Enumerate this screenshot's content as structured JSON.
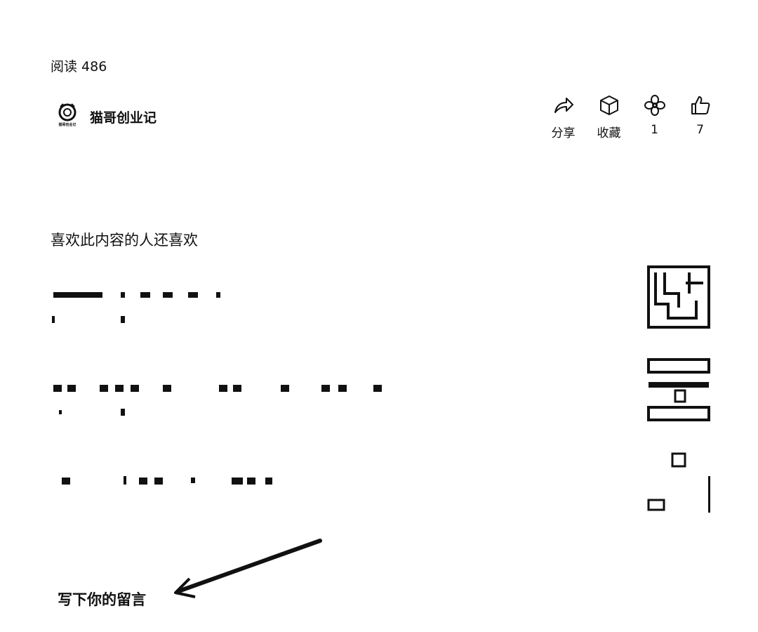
{
  "header": {
    "read_count": "阅读 486"
  },
  "author": {
    "name": "猫哥创业记",
    "avatar_caption": "猫哥创业记"
  },
  "actions": [
    {
      "label": "分享",
      "icon": "share-icon"
    },
    {
      "label": "收藏",
      "icon": "cube-icon"
    },
    {
      "label": "1",
      "icon": "flower-icon"
    },
    {
      "label": "7",
      "icon": "thumbs-up-icon"
    }
  ],
  "recommend": {
    "title": "喜欢此内容的人还喜欢",
    "items": [
      {
        "thumb": "maze-thumbnail"
      },
      {
        "thumb": "document-thumbnail"
      },
      {
        "thumb": "blank-thumbnail"
      }
    ]
  },
  "comment": {
    "prompt": "写下你的留言"
  }
}
